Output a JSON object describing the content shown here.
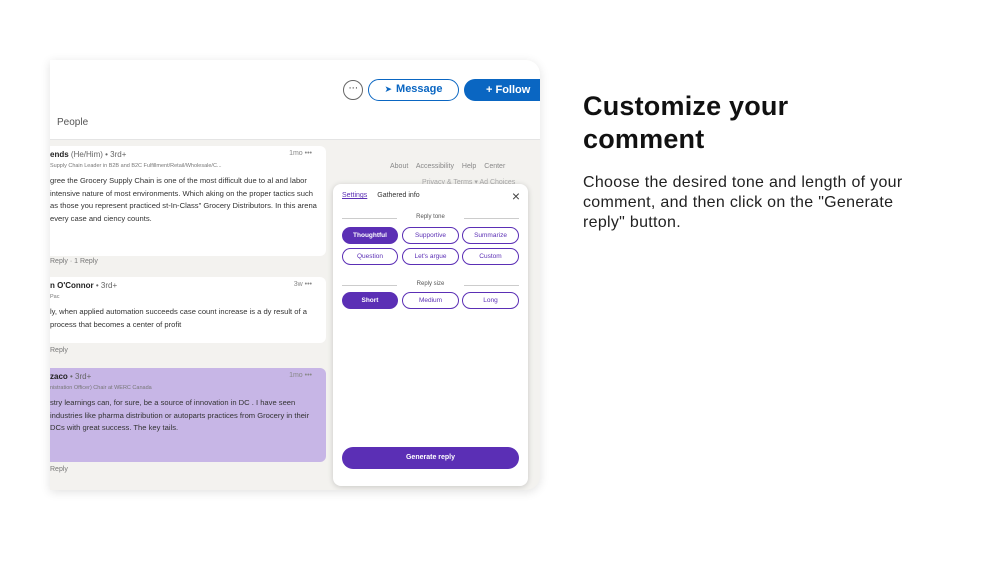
{
  "topbar": {
    "more_label": "···",
    "message_label": "Message",
    "follow_label": "+ Follow",
    "people_tab": "People"
  },
  "footer": {
    "links": "About Accessibility Help Center",
    "links2": "Privacy & Terms ▾ Ad Choices"
  },
  "comments": [
    {
      "name": "ends",
      "degree": "(He/Him) • 3rd+",
      "subtitle": "Supply Chain Leader in B2B and B2C Fulfillment/Retail/Wholesale/C...",
      "time": "1mo •••",
      "body": "gree the Grocery Supply Chain is one of the most difficult due to al and labor intensive nature of most environments. Which aking on the proper tactics such as those you represent practiced st-In-Class\" Grocery Distributors. In this arena every case and ciency counts.",
      "actions": "Reply · 1 Reply"
    },
    {
      "name": "n O'Connor",
      "degree": "• 3rd+",
      "subtitle": "Pac",
      "time": "3w •••",
      "body": "ly, when applied automation succeeds case count increase is a dy result of a process that becomes a center of profit",
      "actions": "Reply"
    },
    {
      "name": "zaco",
      "degree": "• 3rd+",
      "subtitle": "nistration Officer) Chair at WERC Canada",
      "time": "1mo •••",
      "body": "stry learnings can, for sure, be a source of innovation in DC . I have seen industries like pharma distribution or autoparts practices from Grocery in their DCs with great success. The key tails.",
      "actions": "Reply"
    }
  ],
  "panel": {
    "tab_settings": "Settings",
    "tab_gathered": "Gathered info",
    "close_icon": "×",
    "reply_tone_label": "Reply tone",
    "tones": [
      "Thoughtful",
      "Supportive",
      "Summarize",
      "Question",
      "Let's argue",
      "Custom"
    ],
    "selected_tone": "Thoughtful",
    "reply_size_label": "Reply size",
    "sizes": [
      "Short",
      "Medium",
      "Long"
    ],
    "selected_size": "Short",
    "generate_label": "Generate reply"
  },
  "promo": {
    "heading": "Customize your comment",
    "description": "Choose the desired tone and length of your comment, and then click on the \"Generate reply\" button."
  },
  "colors": {
    "accent": "#5b2fb5",
    "linkedin_blue": "#0a66c2",
    "highlight": "#c7b6e6"
  }
}
